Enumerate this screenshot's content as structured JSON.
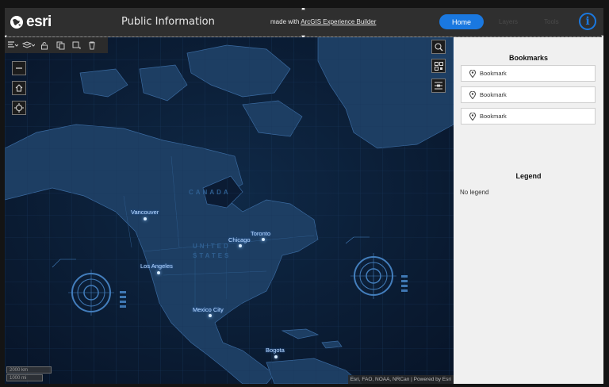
{
  "header": {
    "logo_text": "esri",
    "title": "Public Information",
    "made_with_prefix": "made with",
    "made_with_link": "ArcGIS Experience Builder",
    "nav": [
      {
        "label": "Home",
        "active": true
      },
      {
        "label": "Layers",
        "active": false
      },
      {
        "label": "Tools",
        "active": false
      }
    ],
    "accent_color": "#1a78e0"
  },
  "map": {
    "cities": [
      {
        "name": "Vancouver"
      },
      {
        "name": "Toronto"
      },
      {
        "name": "Chicago"
      },
      {
        "name": "Los Angeles"
      },
      {
        "name": "Mexico City"
      },
      {
        "name": "Bogota"
      }
    ],
    "regions": [
      "CANADA",
      "UNITED",
      "STATES"
    ],
    "scale_km": "2000 km",
    "scale_mi": "1000 mi",
    "attribution": "Esri, FAO, NOAA, NRCan",
    "powered_by": "Powered by Esri",
    "toolbar_icons": [
      "align-icon",
      "layers-icon",
      "lock-icon",
      "copy-icon",
      "duplicate-icon",
      "delete-icon"
    ],
    "controls": [
      "zoom-out-icon",
      "home-icon",
      "locate-icon",
      "search-icon",
      "qr-icon",
      "layer-list-icon"
    ]
  },
  "panel": {
    "bookmarks_title": "Bookmarks",
    "bookmarks": [
      {
        "label": "Bookmark"
      },
      {
        "label": "Bookmark"
      },
      {
        "label": "Bookmark"
      }
    ],
    "legend_title": "Legend",
    "legend_empty": "No legend"
  }
}
